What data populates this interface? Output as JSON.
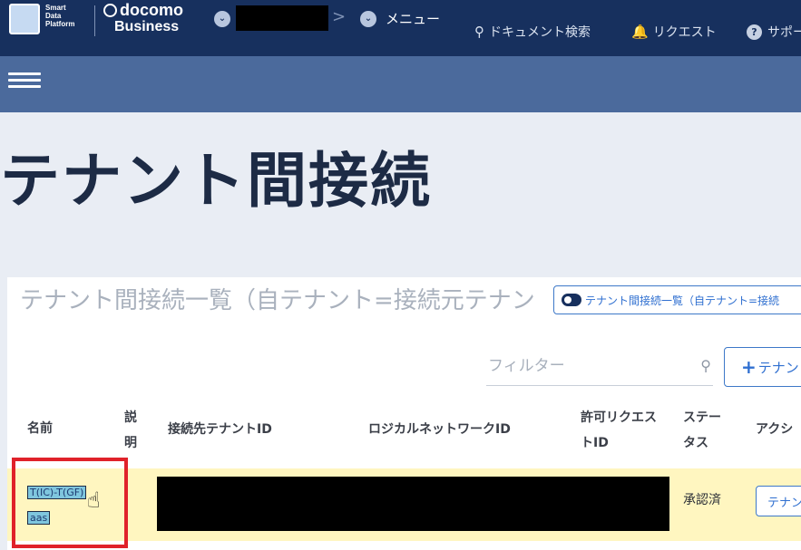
{
  "header": {
    "sdp_logo_lines": [
      "Smart",
      "Data",
      "Platform"
    ],
    "brand_line1": "docomo",
    "brand_line2": "Business",
    "chevron": ">",
    "menu_label": "メニュー",
    "doc_search_label": "ドキュメント検索",
    "request_label": "リクエスト",
    "support_label": "サポート",
    "nav_colors": {
      "bar": "#17305e",
      "subbar": "#4b6a9c"
    }
  },
  "page": {
    "title": "テナント間接続"
  },
  "card": {
    "title": "テナント間接続一覧（自テナント=接続元テナン",
    "toggle_label": "テナント間接続一覧（自テナント=接続",
    "filter_placeholder": "フィルター",
    "add_button_label": "テナン"
  },
  "table": {
    "headers": {
      "name": "名前",
      "description_1": "説",
      "description_2": "明",
      "target_tenant_id": "接続先テナントID",
      "logical_network_id": "ロジカルネットワークID",
      "request_id_1": "許可リクエス",
      "request_id_2": "トID",
      "status_1": "ステー",
      "status_2": "タス",
      "action": "アクシ"
    },
    "rows": [
      {
        "name_line1": "T(IC)-T(GF)",
        "name_line2": "aas",
        "status": "承認済",
        "action_label": "テナン"
      }
    ]
  },
  "icons": {
    "search": "search-icon",
    "bell": "bell-icon",
    "help": "help-icon",
    "menu": "hamburger-icon"
  },
  "accent_colors": {
    "link": "#2f6fd0",
    "highlight_box": "#e0222a",
    "row_highlight": "#fff6c0"
  }
}
